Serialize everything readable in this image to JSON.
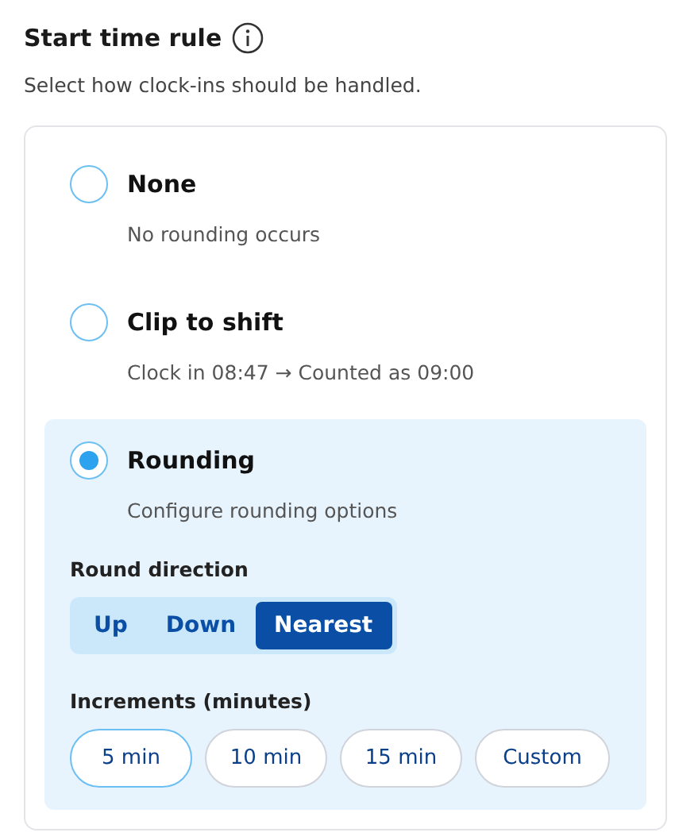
{
  "title": "Start time rule",
  "subtitle": "Select how clock-ins should be handled.",
  "options": [
    {
      "label": "None",
      "description": "No rounding occurs",
      "selected": false
    },
    {
      "label": "Clip to shift",
      "description": "Clock in 08:47 → Counted as 09:00",
      "selected": false
    },
    {
      "label": "Rounding",
      "description": "Configure rounding options",
      "selected": true,
      "settings": {
        "direction_label": "Round direction",
        "directions": [
          {
            "label": "Up",
            "selected": false
          },
          {
            "label": "Down",
            "selected": false
          },
          {
            "label": "Nearest",
            "selected": true
          }
        ],
        "increments_label": "Increments (minutes)",
        "increments": [
          {
            "label": "5 min",
            "selected": true
          },
          {
            "label": "10 min",
            "selected": false
          },
          {
            "label": "15 min",
            "selected": false
          },
          {
            "label": "Custom",
            "selected": false
          }
        ]
      }
    }
  ]
}
